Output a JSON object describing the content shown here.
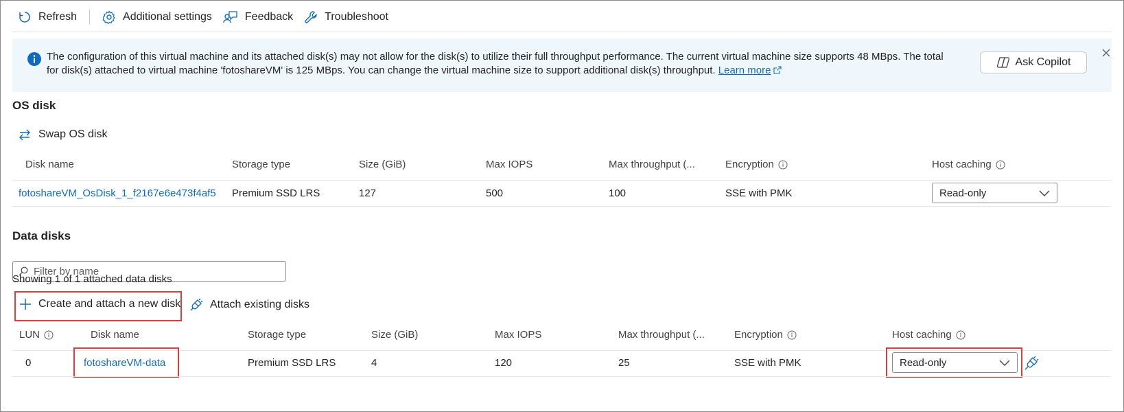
{
  "toolbar": {
    "refresh": "Refresh",
    "additional_settings": "Additional settings",
    "feedback": "Feedback",
    "troubleshoot": "Troubleshoot"
  },
  "banner": {
    "message_line1": "The configuration of this virtual machine and its attached disk(s) may not allow for the disk(s) to utilize their full throughput performance. The current virtual machine size supports 48 MBps. The total",
    "message_line2": "for disk(s) attached to virtual machine 'fotoshareVM' is 125 MBps. You can change the virtual machine size to support additional disk(s) throughput.",
    "learn_more": "Learn more",
    "ask_copilot": "Ask Copilot"
  },
  "os_disk": {
    "title": "OS disk",
    "swap_label": "Swap OS disk",
    "columns": [
      "Disk name",
      "Storage type",
      "Size (GiB)",
      "Max IOPS",
      "Max throughput (...",
      "Encryption",
      "Host caching"
    ],
    "row": {
      "disk_name": "fotoshareVM_OsDisk_1_f2167e6e473f4af5",
      "storage_type": "Premium SSD LRS",
      "size": "127",
      "max_iops": "500",
      "max_throughput": "100",
      "encryption": "SSE with PMK",
      "host_caching": "Read-only"
    }
  },
  "data_disks": {
    "title": "Data disks",
    "filter_placeholder": "Filter by name",
    "showing": "Showing 1 of 1 attached data disks",
    "create_attach": "Create and attach a new disk",
    "attach_existing": "Attach existing disks",
    "columns": [
      "LUN",
      "Disk name",
      "Storage type",
      "Size (GiB)",
      "Max IOPS",
      "Max throughput (...",
      "Encryption",
      "Host caching"
    ],
    "rows": [
      {
        "lun": "0",
        "disk_name": "fotoshareVM-data",
        "storage_type": "Premium SSD LRS",
        "size": "4",
        "max_iops": "120",
        "max_throughput": "25",
        "encryption": "SSE with PMK",
        "host_caching": "Read-only"
      }
    ]
  },
  "colors": {
    "accent": "#0f6cbd",
    "banner_bg": "#eff6fc",
    "highlight": "#e03a3a"
  }
}
